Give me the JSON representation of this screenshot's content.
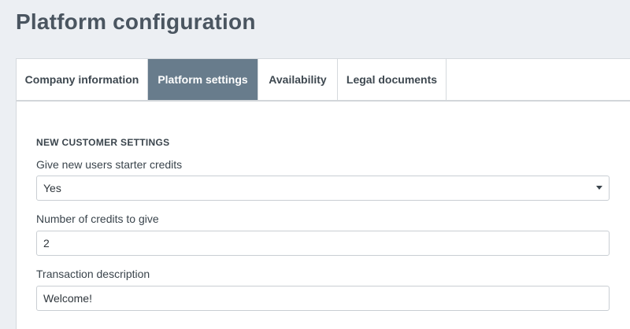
{
  "page": {
    "title": "Platform configuration"
  },
  "tabs": [
    {
      "label": "Company information",
      "active": false
    },
    {
      "label": "Platform settings",
      "active": true
    },
    {
      "label": "Availability",
      "active": false
    },
    {
      "label": "Legal documents",
      "active": false
    }
  ],
  "new_customer_settings": {
    "heading": "NEW CUSTOMER SETTINGS",
    "starter_credits": {
      "label": "Give new users starter credits",
      "value": "Yes"
    },
    "credit_count": {
      "label": "Number of credits to give",
      "value": "2"
    },
    "transaction_description": {
      "label": "Transaction description",
      "value": "Welcome!"
    }
  },
  "colors": {
    "page_background": "#eceff3",
    "active_tab_background": "#687c8c",
    "title_text": "#4a5560"
  }
}
